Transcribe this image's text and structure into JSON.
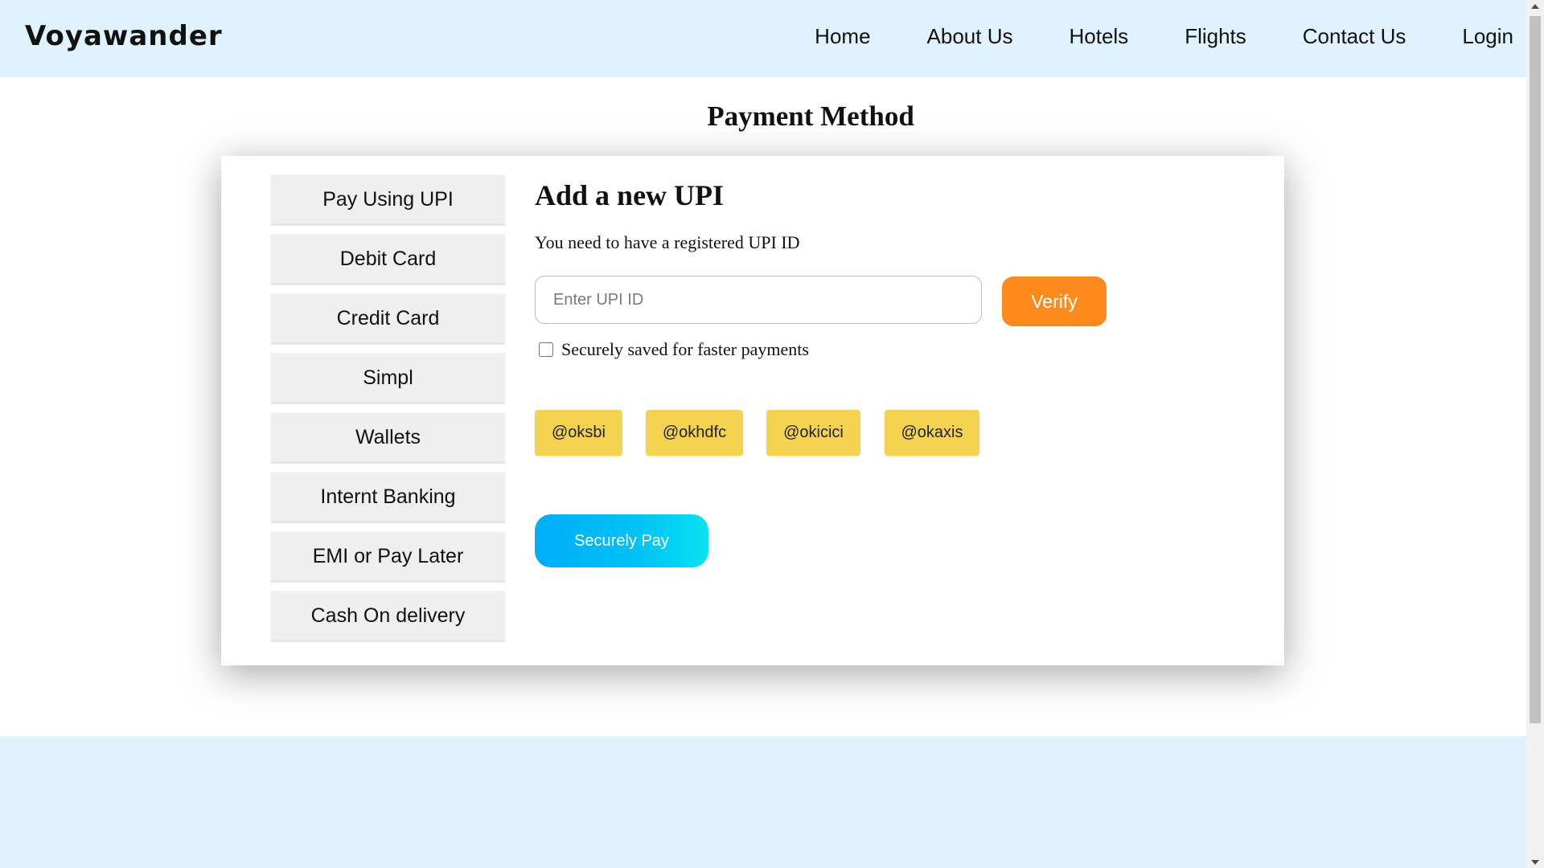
{
  "header": {
    "brand": "Voyawander",
    "nav": [
      "Home",
      "About Us",
      "Hotels",
      "Flights",
      "Contact Us",
      "Login"
    ]
  },
  "page_title": "Payment Method",
  "sidebar": {
    "items": [
      "Pay Using UPI",
      "Debit Card",
      "Credit Card",
      "Simpl",
      "Wallets",
      "Internt Banking",
      "EMI or Pay Later",
      "Cash On delivery"
    ]
  },
  "upi": {
    "title": "Add a new UPI",
    "subtitle": "You need to have a registered UPI ID",
    "input_placeholder": "Enter UPI ID",
    "input_value": "",
    "verify_label": "Verify",
    "save_label": "Securely saved for faster payments",
    "save_checked": false,
    "suffixes": [
      "@oksbi",
      "@okhdfc",
      "@okicici",
      "@okaxis"
    ],
    "pay_label": "Securely Pay"
  },
  "colors": {
    "header_bg": "#dff2fd",
    "verify_bg": "#fd8a1c",
    "suffix_bg": "#f3d34f",
    "pay_gradient_start": "#00adf8",
    "pay_gradient_end": "#0ae2f2"
  }
}
